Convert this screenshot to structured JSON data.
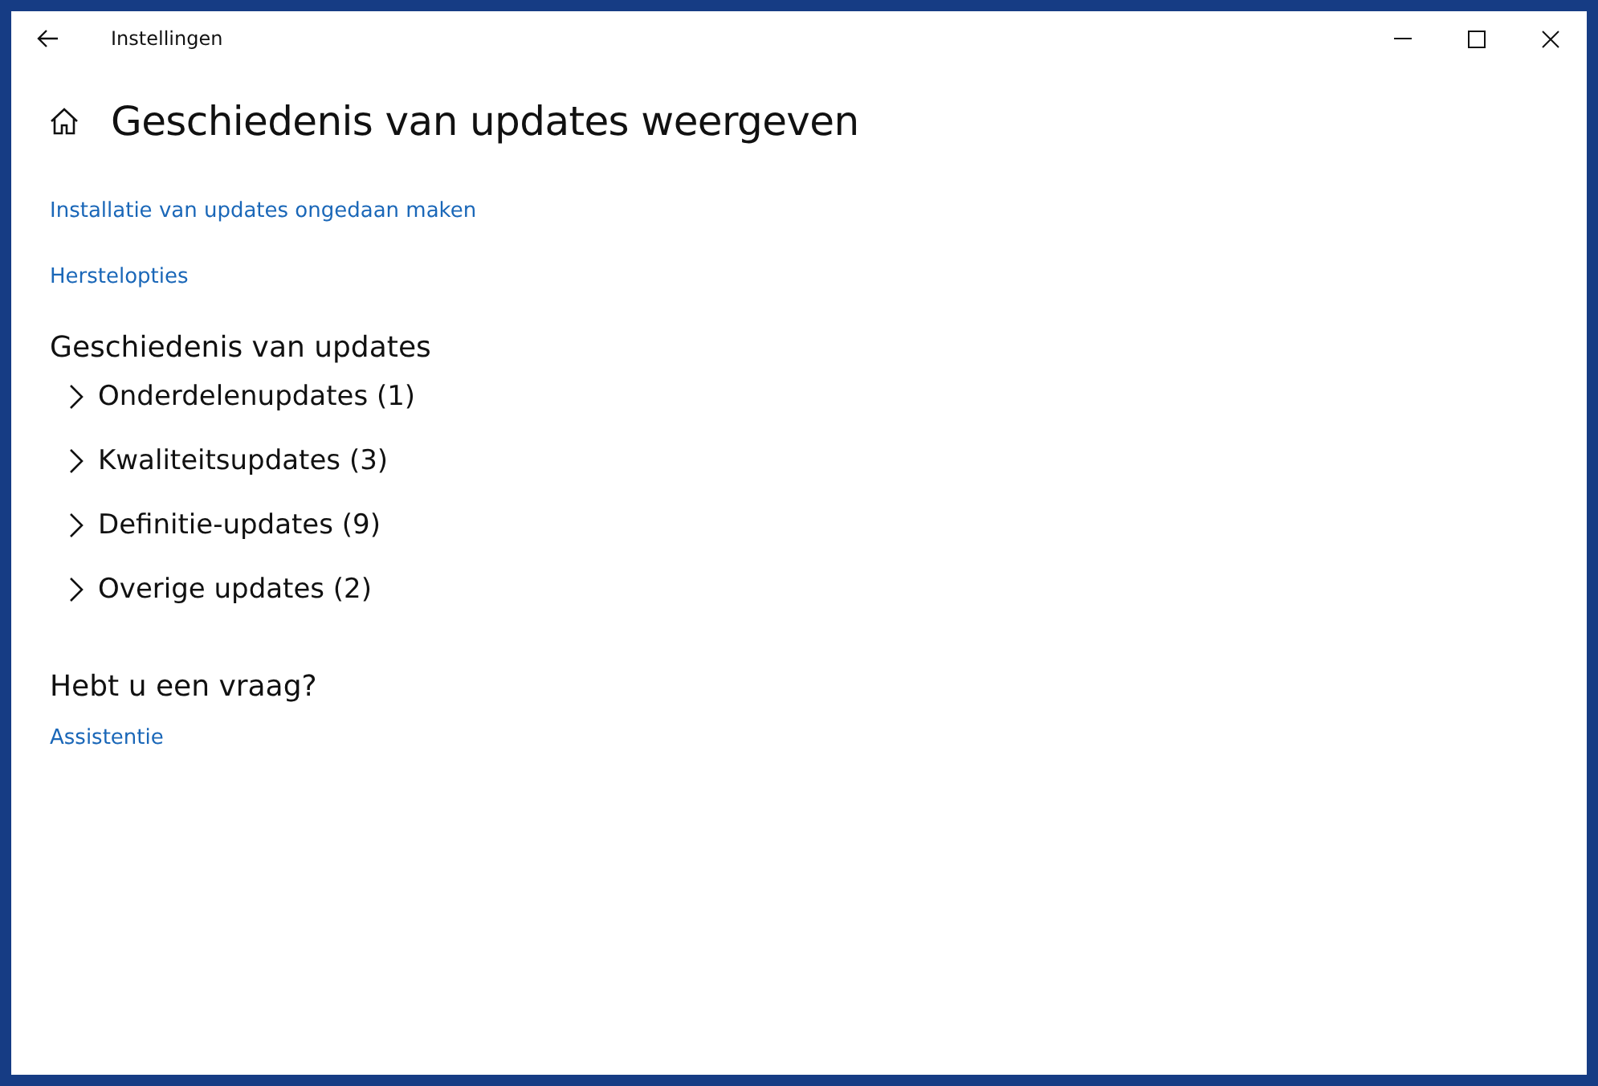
{
  "window": {
    "title": "Instellingen"
  },
  "page": {
    "title": "Geschiedenis van updates weergeven"
  },
  "links": [
    "Installatie van updates ongedaan maken",
    "Herstelopties"
  ],
  "history": {
    "heading": "Geschiedenis van updates",
    "groups": [
      {
        "label": "Onderdelenupdates (1)",
        "expanded": false
      },
      {
        "label": "Kwaliteitsupdates (3)",
        "expanded": false
      },
      {
        "label": "Definitie-updates (9)",
        "expanded": false
      },
      {
        "label": "Overige updates (2)",
        "expanded": false
      }
    ]
  },
  "help": {
    "heading": "Hebt u een vraag?",
    "link": "Assistentie"
  }
}
